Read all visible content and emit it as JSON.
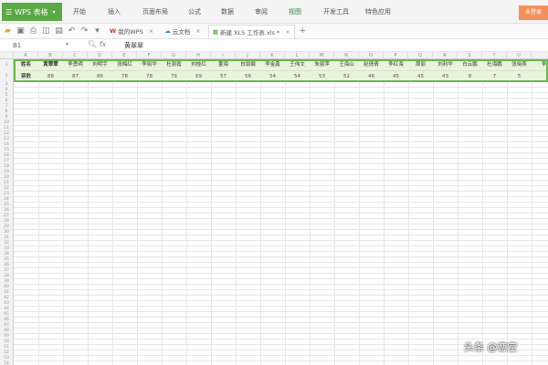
{
  "app": {
    "name": "WPS 表格",
    "dropdown": "▾"
  },
  "menu": [
    {
      "label": "开始",
      "active": false
    },
    {
      "label": "插入",
      "active": false
    },
    {
      "label": "页面布局",
      "active": false
    },
    {
      "label": "公式",
      "active": false
    },
    {
      "label": "数据",
      "active": false
    },
    {
      "label": "审阅",
      "active": false
    },
    {
      "label": "视图",
      "active": true
    },
    {
      "label": "开发工具",
      "active": false
    },
    {
      "label": "特色应用",
      "active": false
    }
  ],
  "corner_button": "未登录",
  "tabs": [
    {
      "label": "我的WPS",
      "close": "×"
    },
    {
      "label": "云文档",
      "close": "×"
    },
    {
      "label": "新建 XLS 工作表.xls *",
      "close": "×"
    }
  ],
  "formula": {
    "name_box": "B1",
    "fx": "fx",
    "value": "黄翠翠"
  },
  "sheet": {
    "col_letters": [
      "A",
      "B",
      "C",
      "D",
      "E",
      "F",
      "G",
      "H",
      "I",
      "J",
      "K",
      "L",
      "M",
      "N",
      "O",
      "P",
      "Q",
      "R",
      "S",
      "T",
      "U"
    ],
    "row_numbers": [
      "1",
      "2",
      "3",
      "4",
      "5",
      "6",
      "7",
      "8",
      "9",
      "10",
      "11",
      "12",
      "13",
      "14",
      "15",
      "16",
      "17",
      "18",
      "19",
      "20",
      "21",
      "22",
      "23",
      "24",
      "25",
      "26",
      "27",
      "28",
      "29",
      "30",
      "31",
      "32",
      "33",
      "34",
      "35",
      "36",
      "37",
      "38",
      "39",
      "40",
      "41",
      "42",
      "43",
      "44",
      "45",
      "46",
      "47",
      "48",
      "49",
      "50",
      "51",
      "52",
      "53",
      "54",
      "55",
      "56"
    ],
    "header_row": [
      "姓名",
      "黄翠翠",
      "李勇明",
      "刘明宇",
      "张梅红",
      "李丽华",
      "杜丽霞",
      "刘桂红",
      "董海",
      "白丽娟",
      "李金鑫",
      "王伟文",
      "朱丽萍",
      "王海山",
      "赵倩倩",
      "李红海",
      "周丽",
      "刘利华",
      "白云鹏",
      "杜海鹏",
      "张晓燕",
      "李"
    ],
    "value_row": [
      "票数",
      "88",
      "87",
      "86",
      "78",
      "78",
      "76",
      "69",
      "57",
      "56",
      "54",
      "54",
      "53",
      "52",
      "46",
      "45",
      "45",
      "43",
      "8",
      "7",
      "5"
    ]
  },
  "watermark": "头条 @恋空"
}
